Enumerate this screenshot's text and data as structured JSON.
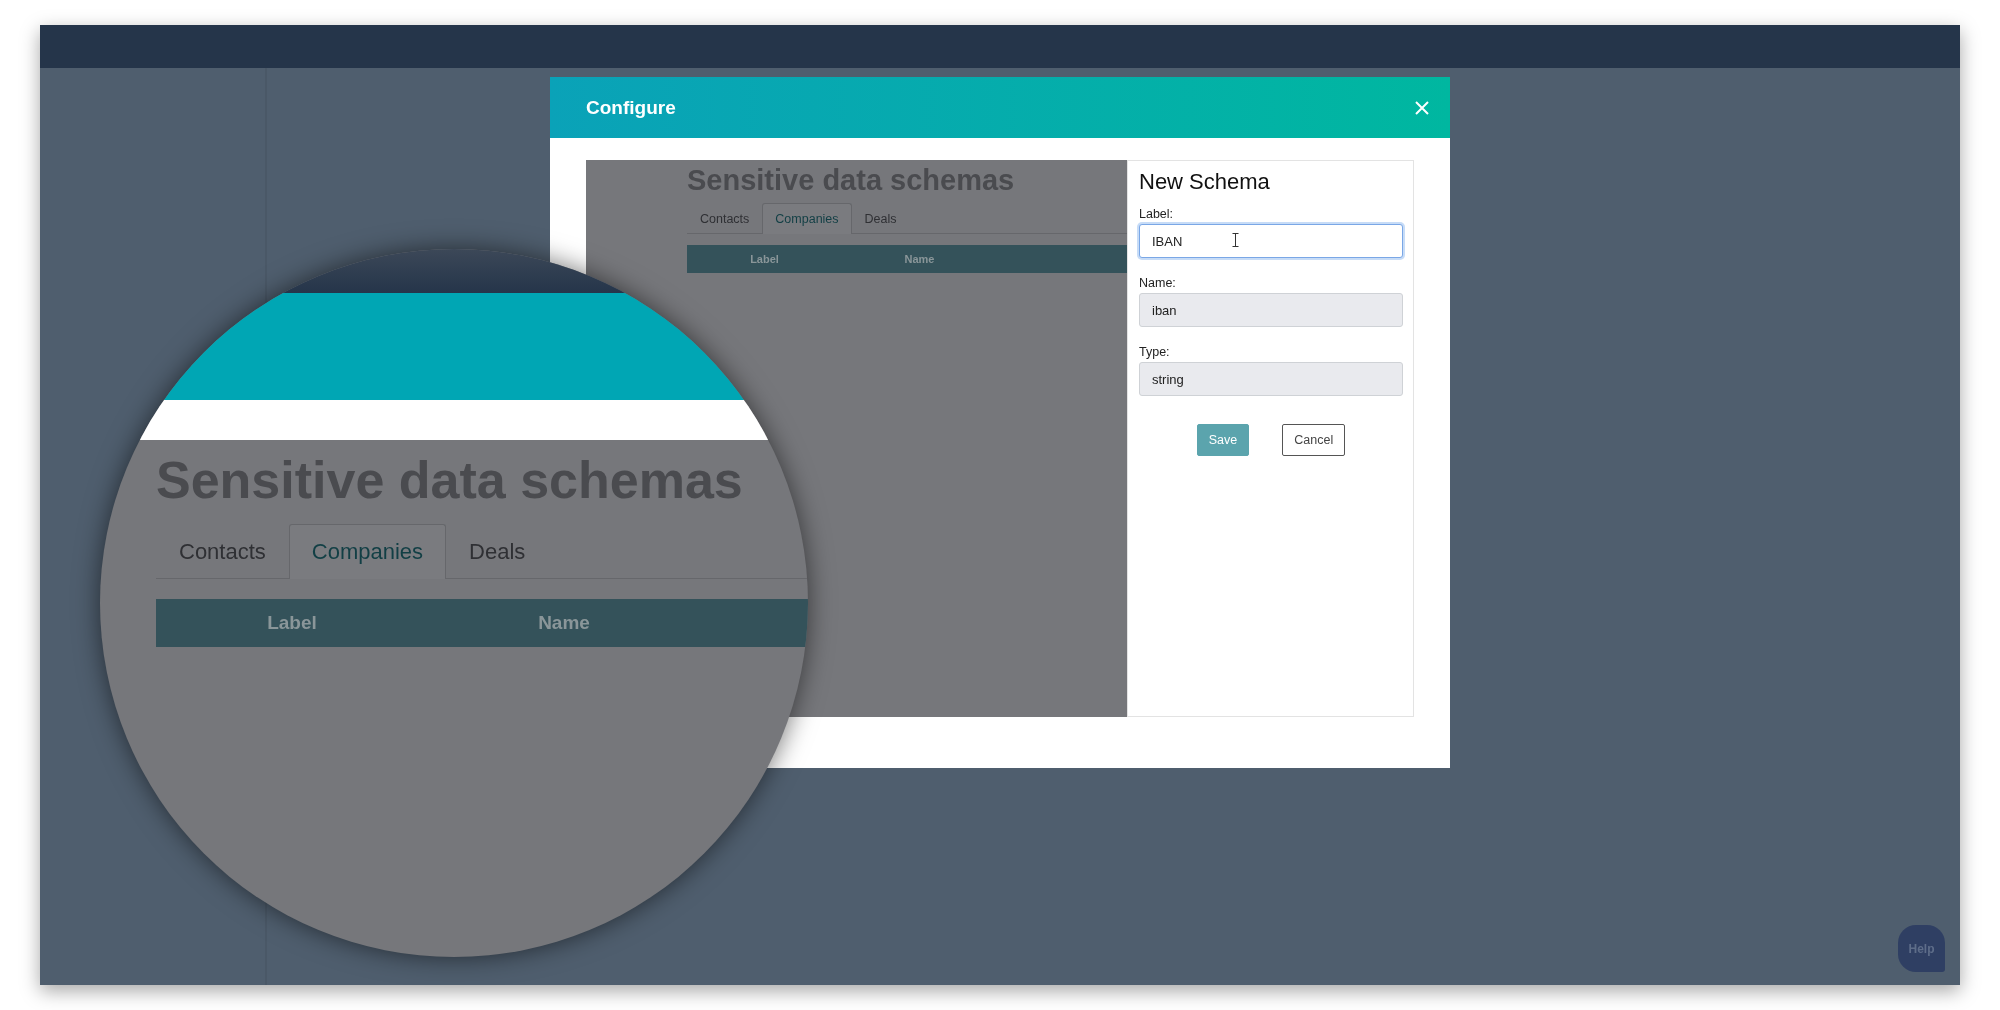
{
  "dialog": {
    "title": "Configure",
    "preview": {
      "title": "Sensitive data schemas",
      "tabs": [
        {
          "label": "Contacts",
          "selected": false
        },
        {
          "label": "Companies",
          "selected": true
        },
        {
          "label": "Deals",
          "selected": false
        }
      ],
      "columns": [
        "Label",
        "Name"
      ]
    },
    "form": {
      "title": "New Schema",
      "fields": [
        {
          "label": "Label:",
          "value": "IBAN",
          "focused": true,
          "readonly": false
        },
        {
          "label": "Name:",
          "value": "iban",
          "focused": false,
          "readonly": true
        },
        {
          "label": "Type:",
          "value": "string",
          "focused": false,
          "readonly": true
        }
      ],
      "buttons": [
        {
          "label": "Save",
          "kind": "primary"
        },
        {
          "label": "Cancel",
          "kind": "secondary"
        }
      ]
    }
  },
  "magnifier": {
    "title": "Sensitive data schemas",
    "tabs": [
      {
        "label": "Contacts",
        "selected": false
      },
      {
        "label": "Companies",
        "selected": true
      },
      {
        "label": "Deals",
        "selected": false
      }
    ],
    "columns": [
      "Label",
      "Name"
    ]
  },
  "help_button": {
    "label": "Help"
  }
}
